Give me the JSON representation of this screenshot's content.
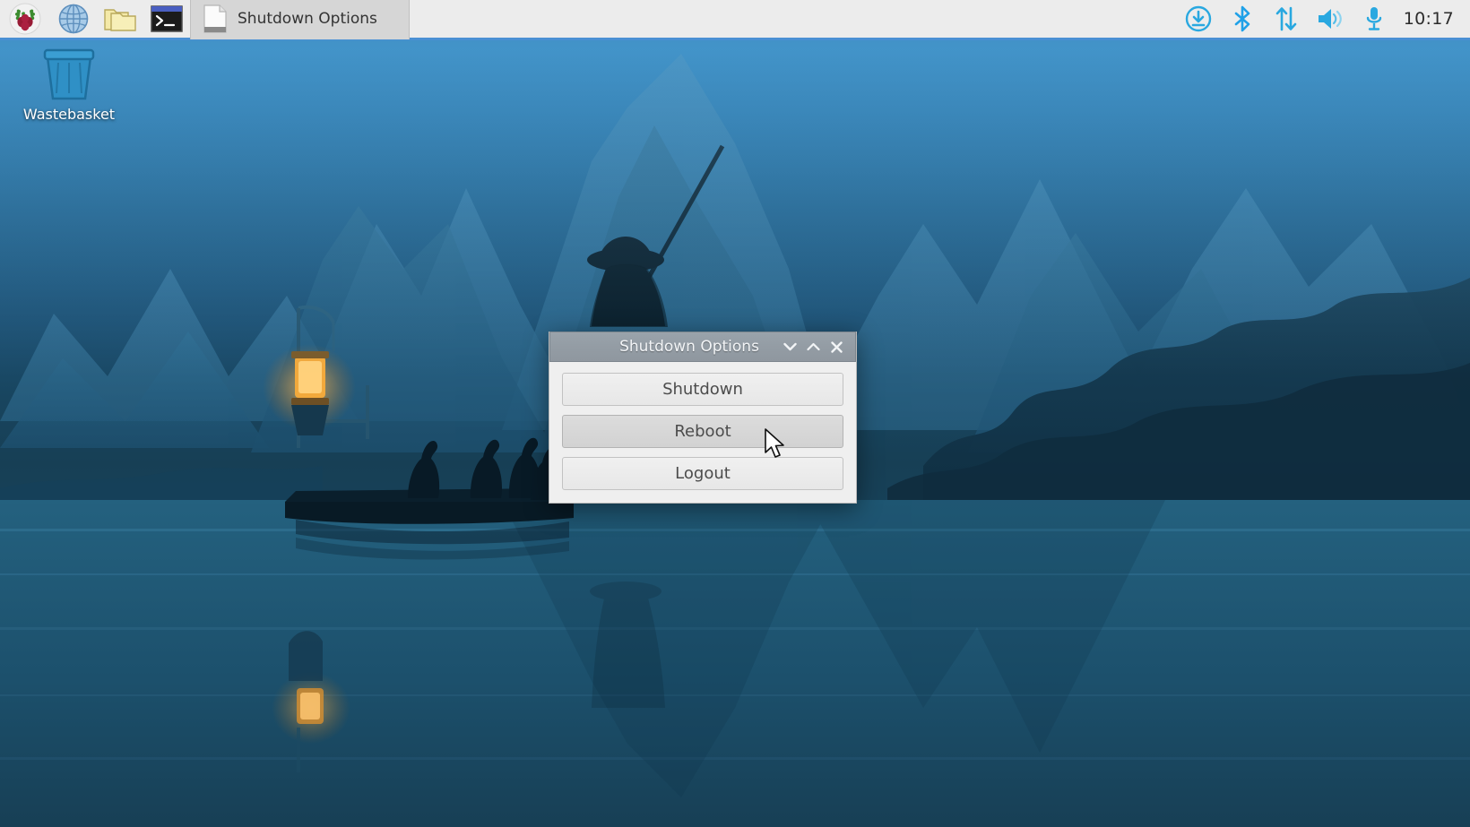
{
  "taskbar": {
    "launchers": [
      {
        "name": "raspberry-menu-icon",
        "label": "Raspberry Pi Menu"
      },
      {
        "name": "web-browser-icon",
        "label": "Web Browser"
      },
      {
        "name": "file-manager-icon",
        "label": "File Manager"
      },
      {
        "name": "terminal-icon",
        "label": "Terminal"
      }
    ],
    "window_button": {
      "title": "Shutdown Options",
      "icon": "window-document-icon"
    },
    "tray": [
      {
        "name": "software-update-icon",
        "label": "Update Available"
      },
      {
        "name": "bluetooth-icon",
        "label": "Bluetooth"
      },
      {
        "name": "network-icon",
        "label": "Network"
      },
      {
        "name": "volume-icon",
        "label": "Volume"
      },
      {
        "name": "microphone-icon",
        "label": "Microphone"
      }
    ],
    "clock": "10:17"
  },
  "desktop": {
    "icons": [
      {
        "name": "wastebasket-icon",
        "label": "Wastebasket"
      }
    ]
  },
  "dialog": {
    "title": "Shutdown Options",
    "titlebar_buttons": [
      {
        "name": "shade-down-button",
        "glyph": "⌄"
      },
      {
        "name": "shade-up-button",
        "glyph": "⌃"
      },
      {
        "name": "close-button",
        "glyph": "✕"
      }
    ],
    "buttons": [
      {
        "name": "shutdown-button",
        "label": "Shutdown",
        "state": "normal"
      },
      {
        "name": "reboot-button",
        "label": "Reboot",
        "state": "hover"
      },
      {
        "name": "logout-button",
        "label": "Logout",
        "state": "normal"
      }
    ]
  },
  "colors": {
    "panel_bg": "#ececec",
    "panel_accent": "#4a90d4",
    "tray_icon": "#29a8e0",
    "titlebar": "#949da5",
    "button_bg": "#ebebeb",
    "button_hover": "#d6d6d6"
  }
}
